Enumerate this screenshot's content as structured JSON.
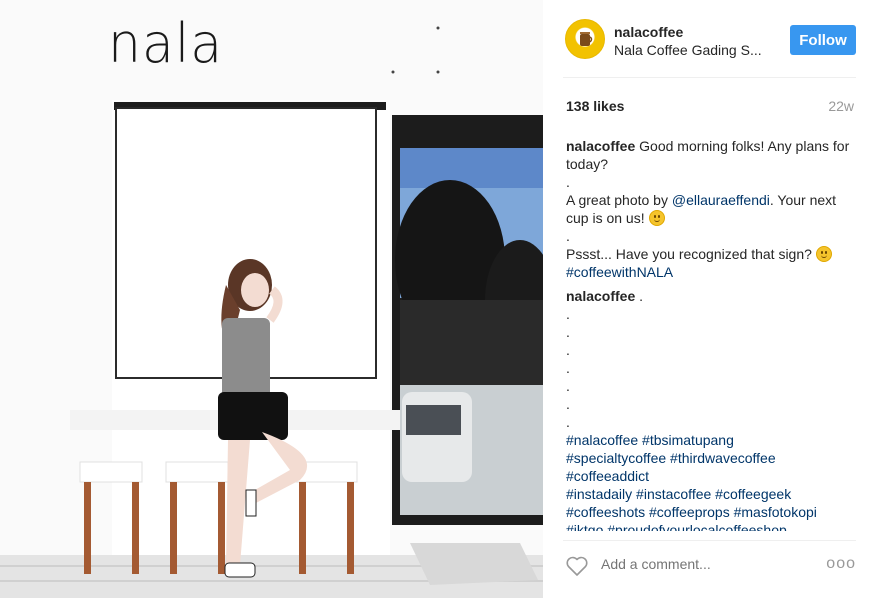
{
  "post": {
    "logo_text": "nala",
    "username": "nalacoffee",
    "location": "Nala Coffee Gading S...",
    "follow_label": "Follow",
    "likes": "138 likes",
    "time_ago": "22w",
    "caption": {
      "username": "nalacoffee",
      "line1": "Good morning folks! Any plans for today?",
      "dot": ".",
      "line2_pre": "A great photo by ",
      "mention": "@ellauraeffendi",
      "line2_post": ". Your next cup is on us!",
      "line3": "Pssst... Have you recognized that sign?",
      "hashtag": "#coffeewithNALA"
    },
    "comment2": {
      "username": "nalacoffee",
      "text": " .",
      "dots": [
        ".",
        ".",
        ".",
        ".",
        ".",
        ".",
        "."
      ],
      "tags_line1": "#nalacoffee #tbsimatupang",
      "tags_line2": "#specialtycoffee #thirdwavecoffee",
      "tags_line3": "#coffeeaddict",
      "tags_line4": "#instadaily #instacoffee #coffeegeek",
      "tags_line5": "#coffeeshots #coffeeprops #masfotokopi",
      "tags_line6": "#iktgo #proudofyourlocalcoffeeshop"
    },
    "add_comment_placeholder": "Add a comment...",
    "more_label": "ooo"
  },
  "colors": {
    "accent": "#3897f0",
    "hashtag": "#003569",
    "muted": "#999999"
  }
}
